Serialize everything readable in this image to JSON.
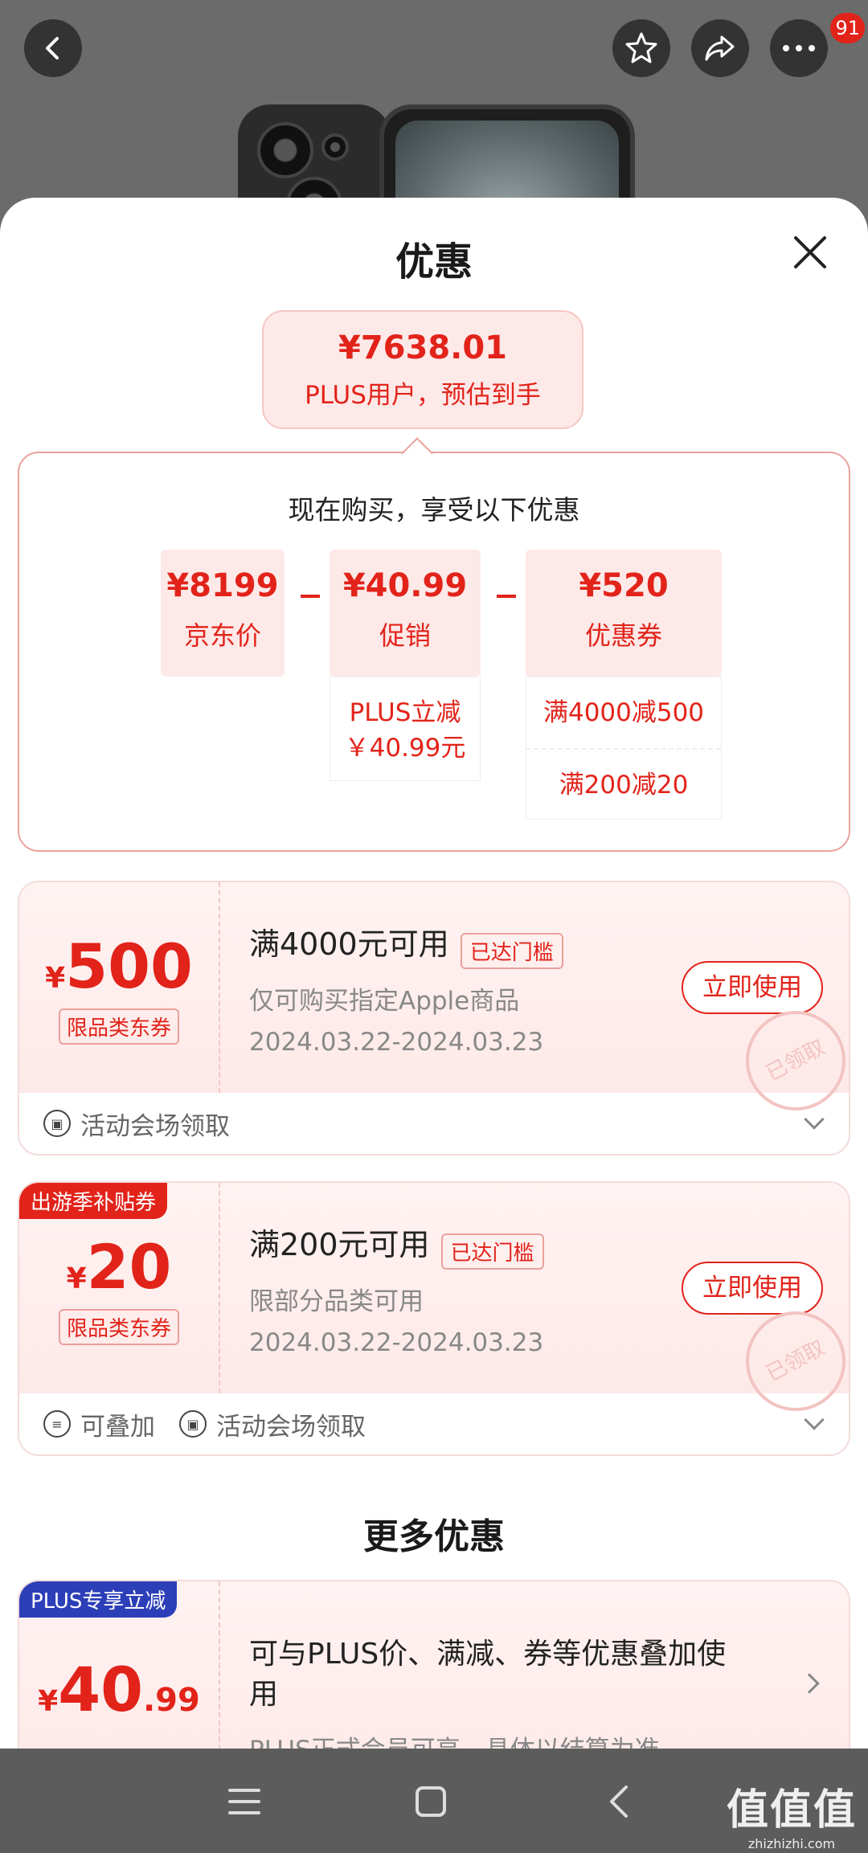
{
  "header": {
    "cart_badge": "91"
  },
  "sheet": {
    "title": "优惠"
  },
  "estimate": {
    "price": "¥7638.01",
    "label": "PLUS用户，预估到手"
  },
  "calc": {
    "title": "现在购买，享受以下优惠",
    "items": [
      {
        "value": "¥8199",
        "label": "京东价"
      },
      {
        "value": "¥40.99",
        "label": "促销"
      },
      {
        "value": "¥520",
        "label": "优惠券"
      }
    ],
    "promo_detail": [
      "PLUS立减",
      "￥40.99元"
    ],
    "coupon_details": [
      "满4000减500",
      "满200减20"
    ]
  },
  "coupons": [
    {
      "currency": "¥",
      "amount": "500",
      "category": "限品类东券",
      "title": "满4000元可用",
      "status": "已达门槛",
      "desc": "仅可购买指定Apple商品",
      "date": "2024.03.22-2024.03.23",
      "button": "立即使用",
      "stamp": "已领取",
      "foot": [
        "活动会场领取"
      ]
    },
    {
      "promo_tag": "出游季补贴券",
      "currency": "¥",
      "amount": "20",
      "category": "限品类东券",
      "title": "满200元可用",
      "status": "已达门槛",
      "desc": "限部分品类可用",
      "date": "2024.03.22-2024.03.23",
      "button": "立即使用",
      "stamp": "已领取",
      "foot": [
        "可叠加",
        "活动会场领取"
      ]
    }
  ],
  "more": {
    "title": "更多优惠",
    "plus": {
      "tag": "PLUS专享立减",
      "currency": "¥",
      "amount": "40",
      "decimal": ".99",
      "desc": "可与PLUS价、满减、券等优惠叠加使用",
      "sub": "PLUS正式会员可享，具体以结算为准"
    }
  },
  "watermark": {
    "big": "值值值",
    "small": "zhizhizhi.com"
  },
  "icons": [
    "back-icon",
    "star-icon",
    "share-icon",
    "more-icon",
    "close-icon",
    "menu-icon",
    "home-icon",
    "nav-back-icon"
  ],
  "colors": {
    "accent": "#e2231a",
    "plus": "#2c3eb8"
  }
}
